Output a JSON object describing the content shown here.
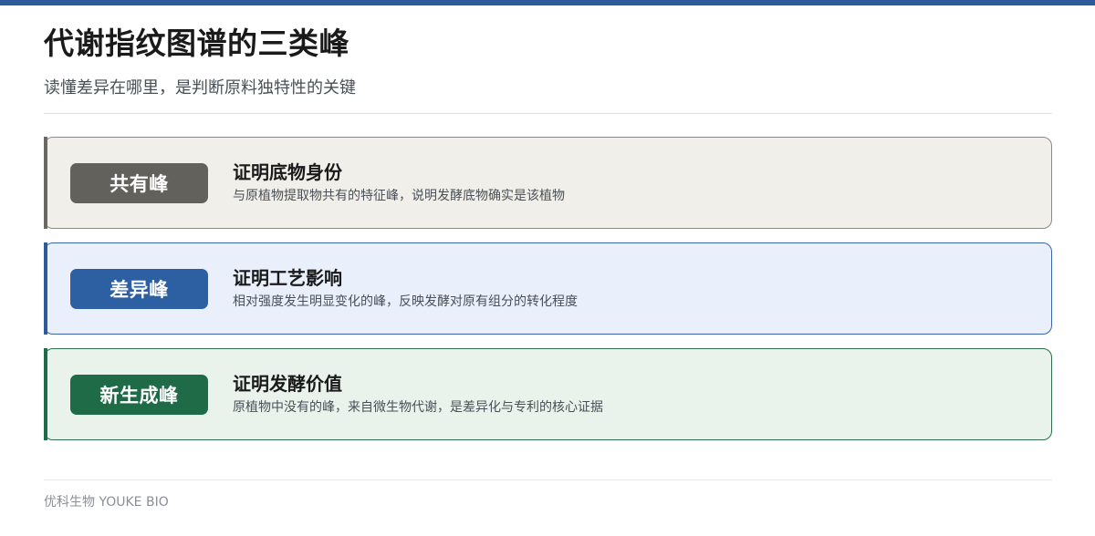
{
  "header": {
    "title": "代谢指纹图谱的三类峰",
    "subtitle": "读懂差异在哪里，是判断原料独特性的关键"
  },
  "cards": [
    {
      "badge": "共有峰",
      "title": "证明底物身份",
      "description": "与原植物提取物共有的特征峰，说明发酵底物确实是该植物",
      "accent_color": "#62615c"
    },
    {
      "badge": "差异峰",
      "title": "证明工艺影响",
      "description": "相对强度发生明显变化的峰，反映发酵对原有组分的转化程度",
      "accent_color": "#2d5fa3"
    },
    {
      "badge": "新生成峰",
      "title": "证明发酵价值",
      "description": "原植物中没有的峰，来自微生物代谢，是差异化与专利的核心证据",
      "accent_color": "#1f6b47"
    }
  ],
  "footer": {
    "brand": "优科生物 YOUKE BIO"
  },
  "colors": {
    "top_bar": "#2d5b9a"
  }
}
